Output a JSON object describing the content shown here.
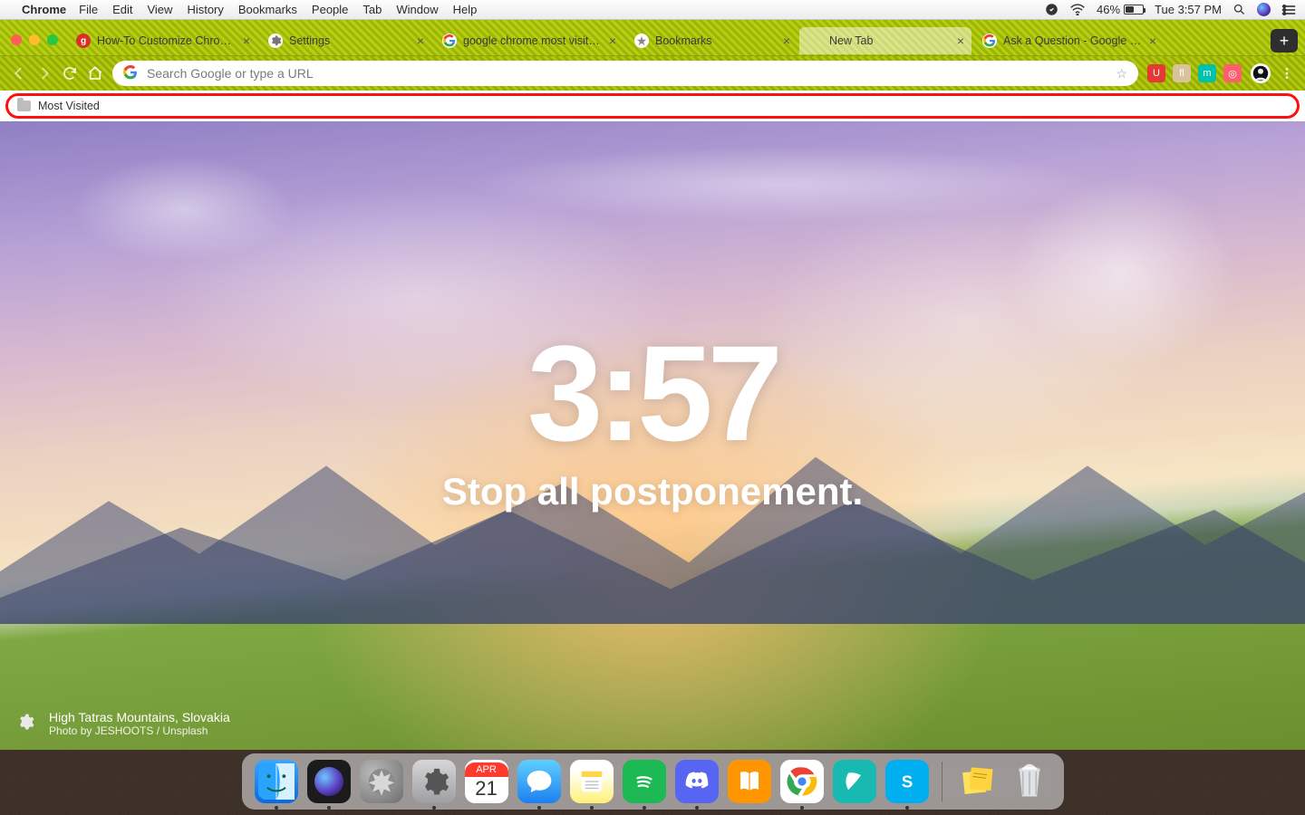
{
  "menubar": {
    "app": "Chrome",
    "items": [
      "File",
      "Edit",
      "View",
      "History",
      "Bookmarks",
      "People",
      "Tab",
      "Window",
      "Help"
    ],
    "battery_pct": "46%",
    "clock": "Tue 3:57 PM"
  },
  "tabs": [
    {
      "label": "How-To Customize Chrom…",
      "favicon": "g",
      "fav_bg": "#d93025",
      "active": false
    },
    {
      "label": "Settings",
      "favicon": "gear",
      "fav_bg": "#ffffff",
      "active": false
    },
    {
      "label": "google chrome most visite…",
      "favicon": "G",
      "fav_bg": "#ffffff",
      "active": false
    },
    {
      "label": "Bookmarks",
      "favicon": "star",
      "fav_bg": "#ffffff",
      "active": false
    },
    {
      "label": "New Tab",
      "favicon": "",
      "fav_bg": "transparent",
      "active": true
    },
    {
      "label": "Ask a Question - Google C…",
      "favicon": "G",
      "fav_bg": "#ffffff",
      "active": false
    }
  ],
  "omnibox": {
    "placeholder": "Search Google or type a URL"
  },
  "extensions": [
    {
      "name": "ublock",
      "bg": "#e53935",
      "txt": "U"
    },
    {
      "name": "ext2",
      "bg": "#d9c39a",
      "txt": "fl"
    },
    {
      "name": "momentum",
      "bg": "#00c2a8",
      "txt": "m"
    },
    {
      "name": "ext4",
      "bg": "#ff5e6c",
      "txt": "◎"
    }
  ],
  "bookmark_bar": {
    "item": "Most Visited"
  },
  "newtab": {
    "clock": "3:57",
    "mantra": "Stop all postponement.",
    "location": "High Tatras Mountains, Slovakia",
    "byline": "Photo by JESHOOTS / Unsplash"
  },
  "calendar": {
    "month": "APR",
    "day": "21"
  },
  "dock_running": [
    "finder",
    "siri",
    "sysprf",
    "msgs",
    "notes",
    "spotify",
    "discord",
    "chrome",
    "skype"
  ]
}
